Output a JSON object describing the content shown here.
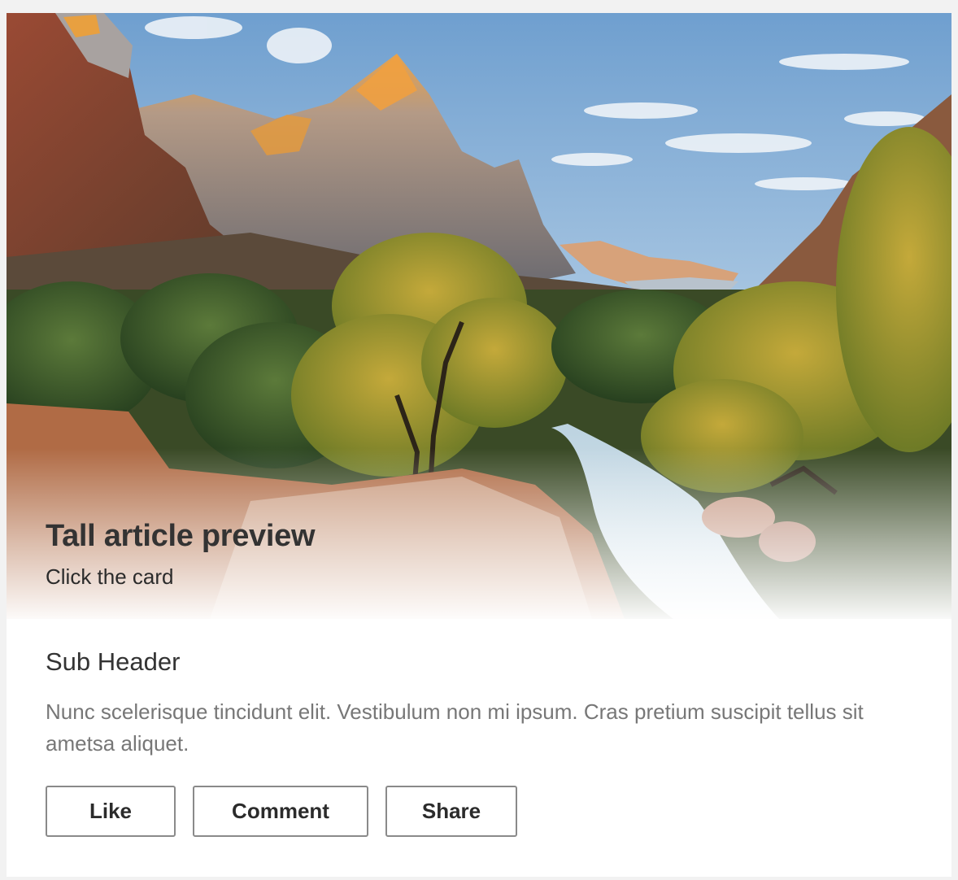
{
  "card": {
    "title": "Tall article preview",
    "subtitle": "Click the card",
    "sub_header": "Sub Header",
    "description": "Nunc scelerisque tincidunt elit. Vestibulum non mi ipsum. Cras pretium suscipit tellus sit ametsa aliquet.",
    "image": "mountain-canyon-river-landscape"
  },
  "actions": {
    "like_label": "Like",
    "comment_label": "Comment",
    "share_label": "Share"
  },
  "colors": {
    "page_background": "#f2f2f2",
    "card_background": "#ffffff",
    "title_text": "#333333",
    "body_text": "#777777",
    "button_border": "#8a8a8a"
  }
}
